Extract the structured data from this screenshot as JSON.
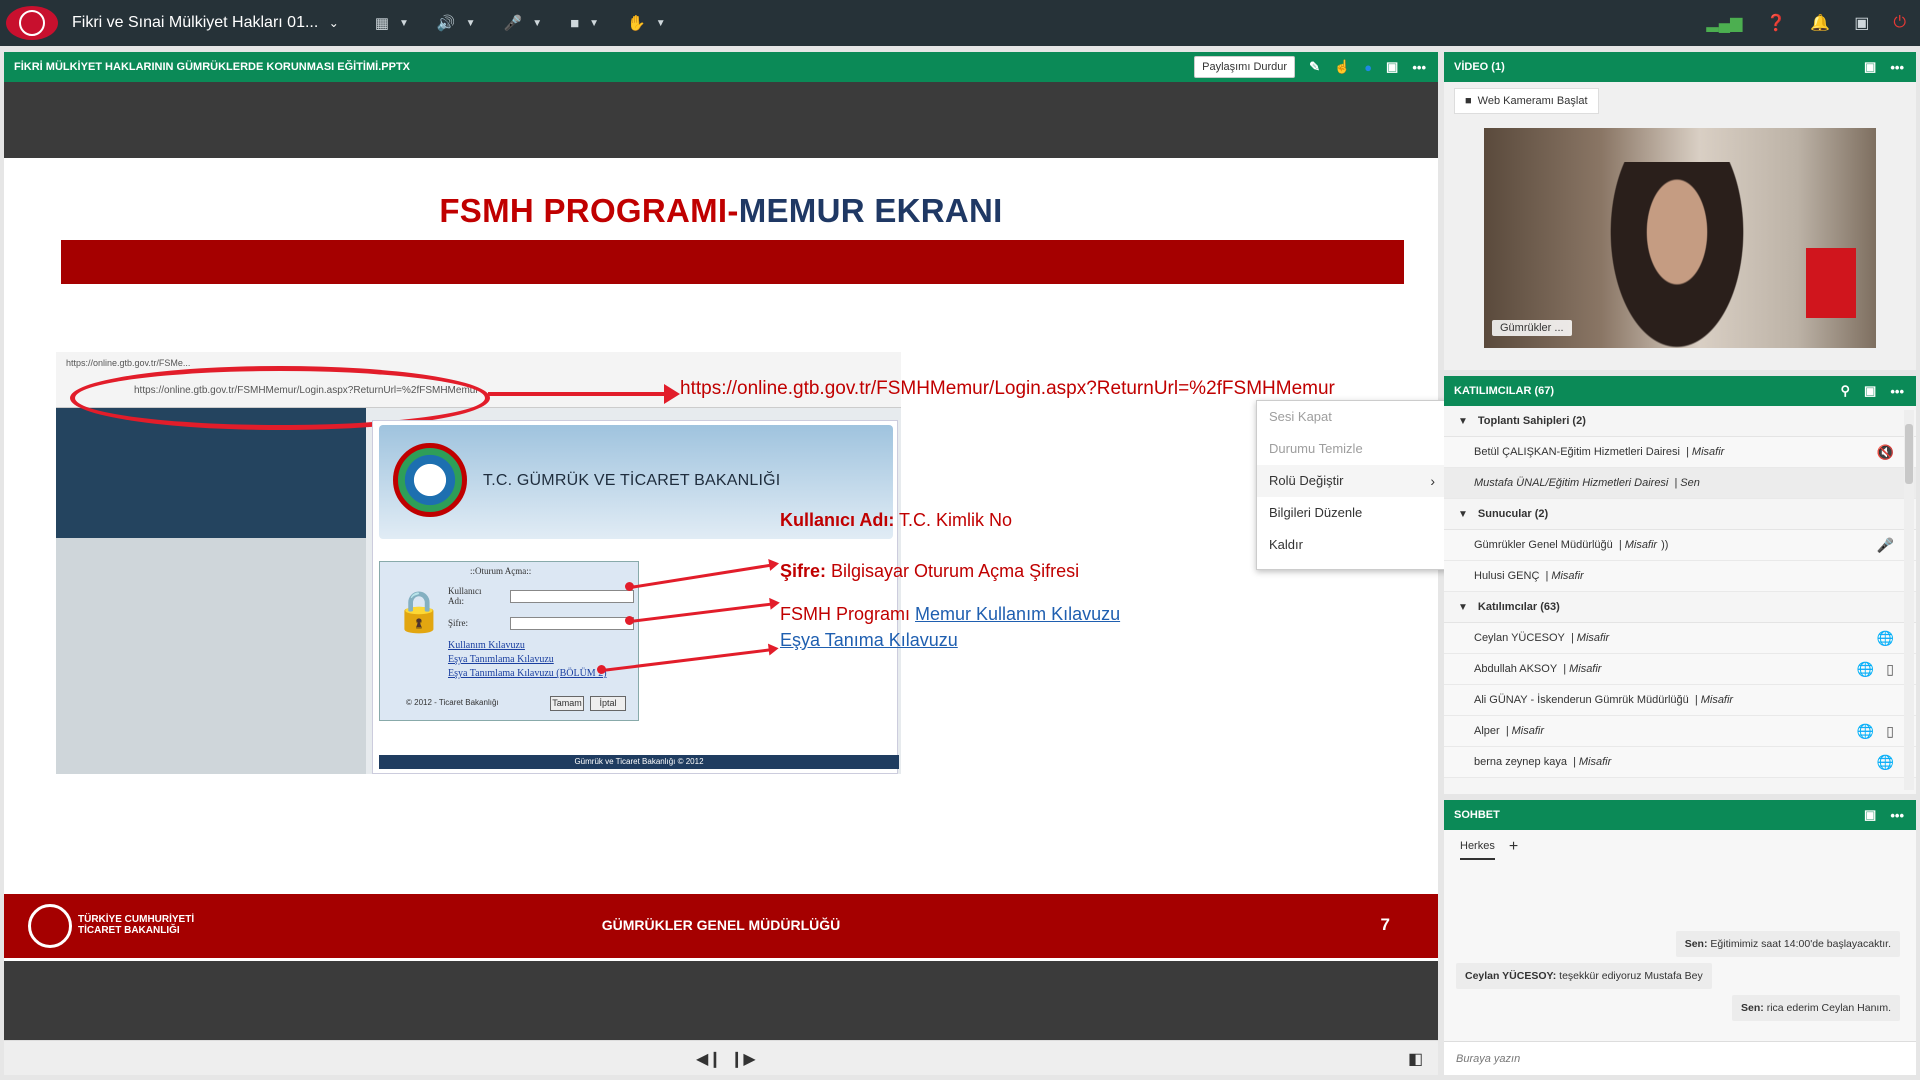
{
  "topbar": {
    "meeting_title": "Fikri ve Sınai Mülkiyet Hakları 01...",
    "icons": [
      "apps-grid-icon",
      "speaker-icon",
      "microphone-icon",
      "camera-icon",
      "raise-hand-icon",
      "signal-icon",
      "help-icon",
      "bell-icon",
      "fullscreen-icon",
      "power-icon"
    ]
  },
  "share_pod": {
    "title": "FİKRİ MÜLKİYET HAKLARININ GÜMRÜKLERDE KORUNMASI EĞİTİMİ.PPTX",
    "stop_share_label": "Paylaşımı Durdur"
  },
  "slide": {
    "title_red": "FSMH PROGRAMI-",
    "title_blue": "MEMUR EKRANI",
    "url": "https://online.gtb.gov.tr/FSMHMemur/Login.aspx?ReturnUrl=%2fFSMHMemur",
    "browser_tab": "https://online.gtb.gov.tr/FSMe...",
    "browser_address": "https://online.gtb.gov.tr/FSMHMemur/Login.aspx?ReturnUrl=%2fFSMHMemur",
    "bank_name": "T.C. GÜMRÜK VE TİCARET BAKANLIĞI",
    "login_title": "::Oturum Açma::",
    "login_user_label": "Kullanıcı Adı:",
    "login_pass_label": "Şifre:",
    "login_links": [
      "Kullanım Kılavuzu",
      "Eşya Tanımlama Kılavuzu",
      "Eşya Tanımlama Kılavuzu (BÖLÜM 2)"
    ],
    "login_copyright": "© 2012 -   Ticaret Bakanlığı",
    "login_ok": "Tamam",
    "login_cancel": "İptal",
    "panel_footer": "Gümrük ve Ticaret Bakanlığı © 2012",
    "anno_user_bold": "Kullanıcı Adı:",
    "anno_user_text": " T.C. Kimlik No",
    "anno_pass_bold": "Şifre:",
    "anno_pass_text": " Bilgisayar Oturum Açma Şifresi",
    "anno_prog_text": "FSMH Programı ",
    "anno_prog_link": "Memur Kullanım Kılavuzu",
    "anno_esya_link": "Eşya Tanıma Kılavuzu",
    "footer_org_line1": "TÜRKİYE CUMHURİYETİ",
    "footer_org_line2": "TİCARET BAKANLIĞI",
    "footer_center": "GÜMRÜKLER GENEL MÜDÜRLÜĞÜ",
    "page_number": "7"
  },
  "context_menu": {
    "items": [
      "Sesi Kapat",
      "Durumu Temizle",
      "Rolü Değiştir",
      "Bilgileri Düzenle",
      "Kaldır"
    ]
  },
  "video_pod": {
    "title": "VİDEO (1)",
    "webcam_button": "Web Kameramı Başlat",
    "feed_label": "Gümrükler ..."
  },
  "attendees_pod": {
    "title": "KATILIMCILAR  (67)",
    "groups": [
      {
        "label": "Toplantı Sahipleri (2)"
      },
      {
        "label": "Sunucular (2)"
      },
      {
        "label": "Katılımcılar (63)"
      }
    ],
    "hosts": [
      {
        "name": "Betül ÇALIŞKAN-Eğitim Hizmetleri Dairesi",
        "role": "| Misafir"
      },
      {
        "name": "Mustafa ÜNAL/Eğitim Hizmetleri Dairesi",
        "role": "| Sen"
      }
    ],
    "presenters": [
      {
        "name": "Gümrükler Genel Müdürlüğü",
        "role": "| Misafir"
      },
      {
        "name": "Hulusi GENÇ",
        "role": "| Misafir"
      }
    ],
    "participants": [
      {
        "name": "Ceylan YÜCESOY",
        "role": "| Misafir"
      },
      {
        "name": "Abdullah AKSOY",
        "role": "| Misafir"
      },
      {
        "name": "Ali GÜNAY - İskenderun Gümrük Müdürlüğü",
        "role": "| Misafir"
      },
      {
        "name": "Alper",
        "role": "| Misafir"
      },
      {
        "name": "berna zeynep kaya",
        "role": "| Misafir"
      }
    ]
  },
  "chat_pod": {
    "title": "SOHBET",
    "tab_everyone": "Herkes",
    "messages": [
      {
        "sender": "Sen:",
        "text": " Eğitimimiz saat 14:00'de başlayacaktır."
      },
      {
        "sender": "Ceylan YÜCESOY:",
        "text": " teşekkür ediyoruz Mustafa Bey"
      },
      {
        "sender": "Sen:",
        "text": " rica ederim Ceylan Hanım."
      }
    ],
    "input_placeholder": "Buraya yazın"
  },
  "colors": {
    "topbar": "#263238",
    "pod_header": "#0b8a57",
    "slide_red": "#a50000",
    "slide_title_blue": "#1f3864"
  }
}
